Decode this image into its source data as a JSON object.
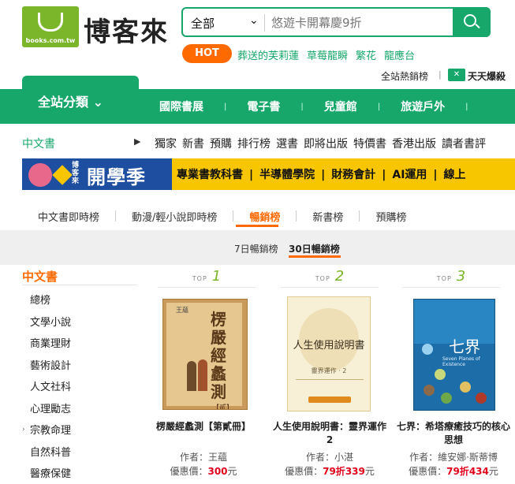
{
  "logo": {
    "text": "博客來",
    "url": "books.com.tw"
  },
  "search": {
    "category": "全部",
    "placeholder": "悠遊卡開幕慶9折"
  },
  "hot": {
    "label": "HOT",
    "links": [
      "葬送的芙莉蓮",
      "草莓龍瞬",
      "繁花",
      "龍應台"
    ]
  },
  "top_links": {
    "bestseller": "全站熱銷榜",
    "daily": "天天爆殺",
    "daily_icon": "✕"
  },
  "nav": {
    "all_categories": "全站分類",
    "items": [
      "國際書展",
      "電子書",
      "兒童館",
      "旅遊戶外"
    ]
  },
  "subnav": {
    "current": "中文書",
    "items": [
      "獨家",
      "新書",
      "預購",
      "排行榜",
      "選書",
      "即將出版",
      "特價書",
      "香港出版",
      "讀者書評"
    ]
  },
  "banner": {
    "brand": "博客來",
    "title": "開學季",
    "items": [
      "專業書教科書",
      "半導體學院",
      "財務會計",
      "AI運用",
      "線上"
    ]
  },
  "tabs": [
    {
      "label": "中文書即時榜",
      "active": false
    },
    {
      "label": "動漫/輕小說即時榜",
      "active": false
    },
    {
      "label": "暢銷榜",
      "active": true
    },
    {
      "label": "新書榜",
      "active": false
    },
    {
      "label": "預購榜",
      "active": false
    }
  ],
  "rank_periods": {
    "week": "7日暢銷榜",
    "month": "30日暢銷榜"
  },
  "sidebar": {
    "title": "中文書",
    "items": [
      "總榜",
      "文學小說",
      "商業理財",
      "藝術設計",
      "人文社科",
      "心理勵志",
      "宗教命理",
      "自然科普",
      "醫療保健"
    ]
  },
  "products": [
    {
      "top_label": "TOP",
      "rank": "1",
      "title": "楞嚴經蠡測【第貳冊】",
      "author_label": "作者：",
      "author": "王蘊",
      "price_label": "優惠價：",
      "discount": "",
      "price": "300",
      "unit": "元",
      "cover": {
        "title": "楞嚴經蠡測",
        "sub": "王蘊",
        "vol": "【貳】"
      }
    },
    {
      "top_label": "TOP",
      "rank": "2",
      "title": "人生使用說明書：靈界運作2",
      "author_label": "作者：",
      "author": "小湛",
      "price_label": "優惠價：",
      "discount": "79折",
      "price": "339",
      "unit": "元",
      "cover": {
        "title": "人生使用說明書",
        "sub": "靈界運作 · 2"
      }
    },
    {
      "top_label": "TOP",
      "rank": "3",
      "title": "七界：希塔療癒技巧的核心思想",
      "author_label": "作者：",
      "author": "維安娜·斯蒂博",
      "price_label": "優惠價：",
      "discount": "79折",
      "price": "434",
      "unit": "元",
      "cover": {
        "title": "七界",
        "sub": "Seven Planes of Existence"
      }
    }
  ],
  "colors": {
    "brand_green": "#17a76a",
    "accent_orange": "#ff6a00",
    "price_red": "#e0001b"
  }
}
